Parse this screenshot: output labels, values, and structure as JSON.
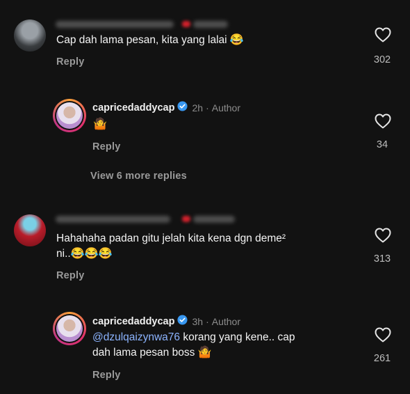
{
  "comments": [
    {
      "text": "Cap dah lama pesan, kita yang lalai",
      "emoji": "😂",
      "reply_label": "Reply",
      "likes": "302"
    },
    {
      "text_line1": "Hahahaha padan gitu jelah kita kena dgn deme²",
      "text_line2": "ni..",
      "emoji": "😂😂😂",
      "reply_label": "Reply",
      "likes": "313"
    }
  ],
  "author_replies": [
    {
      "username": "capricedaddycap",
      "time": "2h",
      "tag": "Author",
      "emoji": "🤷",
      "reply_label": "Reply",
      "likes": "34"
    },
    {
      "username": "capricedaddycap",
      "time": "3h",
      "tag": "Author",
      "mention": "@dzulqaizynwa76",
      "text_line1": " korang yang kene.. cap",
      "text_line2": "dah lama pesan boss",
      "emoji": "🤷",
      "reply_label": "Reply",
      "likes": "261"
    }
  ],
  "view_more": "View 6 more replies",
  "colors": {
    "background": "#121212",
    "verified": "#3897f0",
    "mention": "#8cb4ff",
    "story_ring": "#e1306c"
  },
  "icons": [
    "heart-icon",
    "verified-badge-icon"
  ]
}
